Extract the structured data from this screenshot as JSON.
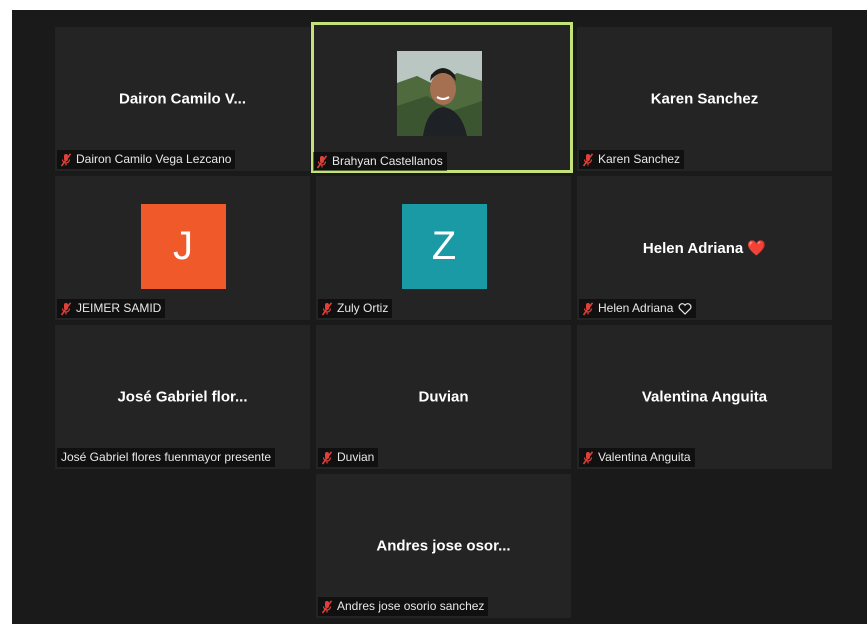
{
  "colors": {
    "background": "#1a1a1a",
    "tile": "#242424",
    "active_border": "#c3e27a",
    "muted_mic": "#e0403a",
    "avatar_orange": "#f0592a",
    "avatar_teal": "#1a9aa5"
  },
  "participants": [
    {
      "display": "Dairon Camilo V...",
      "name": "Dairon Camilo Vega Lezcano",
      "muted": true
    },
    {
      "display": "",
      "name": "Brahyan Castellanos",
      "muted": true,
      "video": true,
      "active_speaker": true
    },
    {
      "display": "Karen Sanchez",
      "name": "Karen Sanchez",
      "muted": true
    },
    {
      "avatar_letter": "J",
      "name": "JEIMER SAMID",
      "muted": true,
      "avatar_color": "#f0592a"
    },
    {
      "avatar_letter": "Z",
      "name": "Zuly Ortiz",
      "muted": true,
      "avatar_color": "#1a9aa5"
    },
    {
      "display": "Helen  Adriana ❤️",
      "name": "Helen Adriana",
      "muted": true,
      "heart_icon": "heart-outline-icon"
    },
    {
      "display": "José  Gabriel  flor...",
      "name": "José Gabriel flores fuenmayor presente",
      "muted": false
    },
    {
      "display": "Duvian",
      "name": "Duvian",
      "muted": true
    },
    {
      "display": "Valentina  Anguita",
      "name": "Valentina Anguita",
      "muted": true
    },
    {
      "display": "Andres  jose  osor...",
      "name": "Andres jose osorio sanchez",
      "muted": true
    }
  ]
}
